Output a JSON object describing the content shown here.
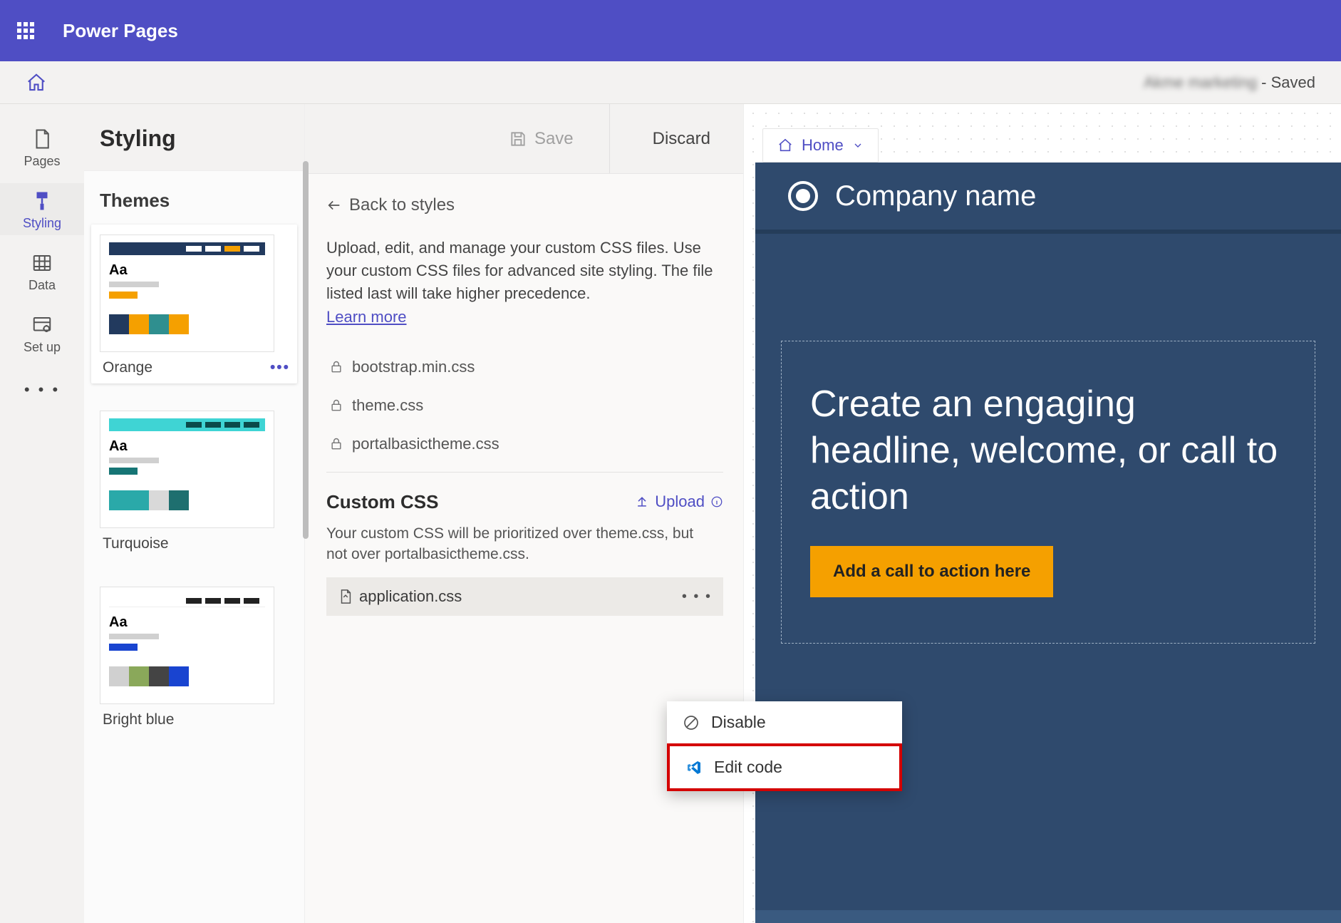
{
  "app": {
    "brand": "Power Pages"
  },
  "crumb": {
    "site_name": "Akme marketing",
    "state": " - Saved"
  },
  "rail": {
    "pages": "Pages",
    "styling": "Styling",
    "data": "Data",
    "setup": "Set up"
  },
  "styling": {
    "title": "Styling",
    "save": "Save",
    "discard": "Discard",
    "themes_label": "Themes",
    "themes": [
      {
        "name": "Orange",
        "aa": "Aa"
      },
      {
        "name": "Turquoise",
        "aa": "Aa"
      },
      {
        "name": "Bright blue",
        "aa": "Aa"
      }
    ]
  },
  "mid": {
    "back": "Back to styles",
    "desc": "Upload, edit, and manage your custom CSS files. Use your custom CSS files for advanced site styling. The file listed last will take higher precedence.",
    "learn": "Learn more",
    "locked_files": [
      "bootstrap.min.css",
      "theme.css",
      "portalbasictheme.css"
    ],
    "custom_title": "Custom CSS",
    "upload": "Upload",
    "custom_note": "Your custom CSS will be prioritized over theme.css, but not over portalbasictheme.css.",
    "custom_file": "application.css"
  },
  "menu": {
    "disable": "Disable",
    "edit": "Edit code"
  },
  "preview": {
    "bc_label": "Home",
    "company": "Company name",
    "headline": "Create an engaging headline, welcome, or call to action",
    "cta": "Add a call to action here"
  },
  "colors": {
    "orange": [
      "#223a5e",
      "#f5a000",
      "#2f8f8f",
      "#f5a000"
    ],
    "turquoise": [
      "#2aa9a9",
      "#2aa9a9",
      "#d9d9d9",
      "#1e6f6f"
    ],
    "blue": [
      "#d0d0d0",
      "#8aa85a",
      "#444444",
      "#1944d0"
    ]
  }
}
